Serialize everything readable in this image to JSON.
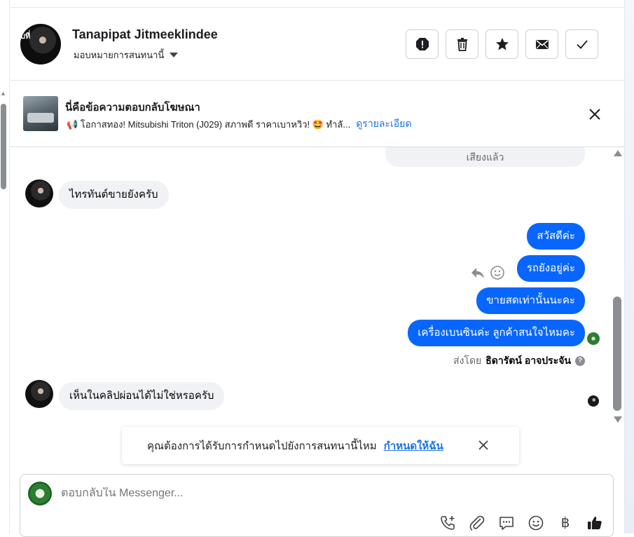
{
  "header": {
    "contact_name": "Tanapipat Jitmeeklindee",
    "assign_label": "มอบหมายการสนทนานี้",
    "avatar_tag": "บที่",
    "actions": [
      "spam-icon",
      "trash-icon",
      "star-icon",
      "envelope-icon",
      "check-icon"
    ]
  },
  "ad": {
    "title": "นี่คือข้อความตอบกลับโฆษณา",
    "description": "📢 โอกาสทอง! Mitsubishi Triton (J029) สภาพดี ราคาเบาหวิว! 🤩 ทำลั...",
    "link": "ดูรายละเอียด"
  },
  "messages": {
    "cut_off": "เสียงแล้ว",
    "incoming_1": "ไทรทันต์ขายยังครับ",
    "outgoing": [
      "สวัสดีค่ะ",
      "รถยังอยู่ค่ะ",
      "ขายสดเท่านั้นนะคะ",
      "เครื่องเบนซินค่ะ ลูกค้าสนใจไหมคะ"
    ],
    "sent_by_prefix": "ส่งโดย",
    "sent_by_name": "ธิดารัตน์ อาจประจัน",
    "incoming_2": "เห็นในคลิปผ่อนได้ไม่ใช่หรอครับ"
  },
  "assign_prompt": {
    "text": "คุณต้องการได้รับการกำหนดไปยังการสนทนานี้ไหม",
    "link": "กำหนดให้ฉัน"
  },
  "composer": {
    "placeholder": "ตอบกลับใน Messenger...",
    "currency_symbol": "฿"
  },
  "colors": {
    "accent": "#0866ff",
    "link": "#1b74e4",
    "incoming_bubble": "#f0f2f5"
  }
}
